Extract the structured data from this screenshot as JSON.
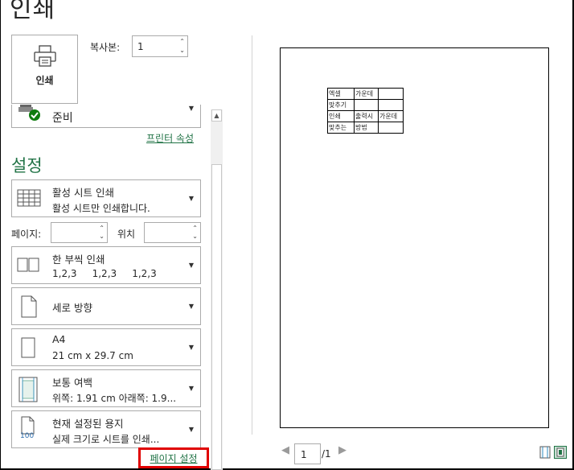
{
  "title": "인쇄",
  "print_button": {
    "label": "인쇄"
  },
  "copies": {
    "label": "복사본:",
    "value": "1"
  },
  "printer": {
    "status": "준비",
    "properties_link": "프린터 속성"
  },
  "settings": {
    "header": "설정",
    "print_what": {
      "title": "활성 시트 인쇄",
      "subtitle": "활성 시트만 인쇄합니다."
    },
    "pages": {
      "label": "페이지:",
      "to_label": "위치",
      "from_value": "",
      "to_value": ""
    },
    "collation": {
      "title": "한 부씩 인쇄",
      "subtitle": "1,2,3     1,2,3     1,2,3"
    },
    "orientation": {
      "title": "세로 방향"
    },
    "paper": {
      "title": "A4",
      "subtitle": "21 cm x 29.7 cm"
    },
    "margins": {
      "title": "보통 여백",
      "subtitle": "위쪽: 1.91 cm 아래쪽: 1.9..."
    },
    "scaling": {
      "title": "현재 설정된 용지",
      "subtitle": "실제 크기로 시트를 인쇄...",
      "icon_text": "100"
    },
    "page_setup_link": "페이지 설정"
  },
  "preview": {
    "sheet_rows": [
      [
        "엑셀",
        "가운데",
        ""
      ],
      [
        "맞추기",
        "",
        ""
      ],
      [
        "인쇄",
        "출력시",
        "가운데"
      ],
      [
        "맞추는",
        "방법",
        ""
      ]
    ],
    "current_page": "1",
    "total_pages": "/1"
  },
  "colors": {
    "accent": "#217346",
    "highlight": "#e00000"
  }
}
